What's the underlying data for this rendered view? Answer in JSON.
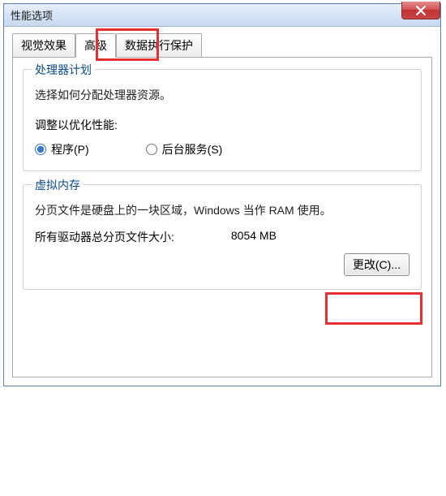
{
  "dialog": {
    "title": "性能选项"
  },
  "tabs": {
    "visual": "视觉效果",
    "advanced": "高级",
    "dep": "数据执行保护"
  },
  "cpu": {
    "group_title": "处理器计划",
    "desc": "选择如何分配处理器资源。",
    "optimize_label": "调整以优化性能:",
    "radio_programs": "程序(P)",
    "radio_background": "后台服务(S)"
  },
  "vm": {
    "group_title": "虚拟内存",
    "desc": "分页文件是硬盘上的一块区域，Windows 当作 RAM 使用。",
    "size_label": "所有驱动器总分页文件大小:",
    "size_value": "8054 MB",
    "change_button": "更改(C)..."
  },
  "highlight_color": "#e63030"
}
